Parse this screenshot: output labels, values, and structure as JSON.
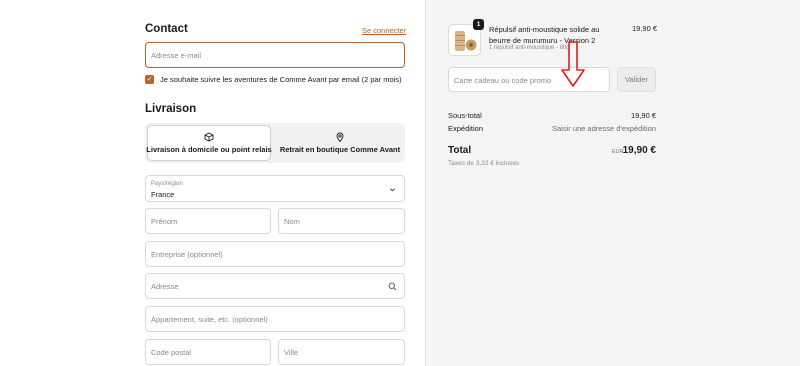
{
  "contact": {
    "heading": "Contact",
    "login_link": "Se connecter",
    "email_placeholder": "Adresse e-mail",
    "newsletter_label": "Je souhaite suivre les aventures de Comme Avant par email (2 par mois)",
    "newsletter_checked": true
  },
  "delivery": {
    "heading": "Livraison",
    "tabs": [
      {
        "label": "Livraison à domicile ou point relais",
        "icon": "package-icon",
        "selected": true
      },
      {
        "label": "Retrait en boutique Comme Avant",
        "icon": "map-pin-icon",
        "selected": false
      }
    ],
    "country": {
      "label": "Pays/région",
      "value": "France"
    },
    "placeholders": {
      "first_name": "Prénom",
      "last_name": "Nom",
      "company": "Entreprise (optionnel)",
      "address": "Adresse",
      "apartment": "Appartement, suite, etc. (optionnel)",
      "postal_code": "Code postal",
      "city": "Ville"
    }
  },
  "summary": {
    "product": {
      "quantity": "1",
      "name": "Répulsif anti-moustique solide au beurre de murumuru - Version 2",
      "variant": "1 répulsif anti-moustique - 80g",
      "price": "19,90 €"
    },
    "promo_placeholder": "Carte cadeau ou code promo",
    "validate_label": "Valider",
    "subtotal_label": "Sous-total",
    "subtotal_value": "19,90 €",
    "shipping_label": "Expédition",
    "shipping_value": "Saisir une adresse d'expédition",
    "total_label": "Total",
    "currency": "EUR",
    "total_value": "19,90 €",
    "taxes_note": "Taxes de 3,32 € incluses"
  },
  "colors": {
    "accent": "#b5652d",
    "annotation_arrow": "#e02020",
    "summary_bg": "#f5f5f5"
  }
}
